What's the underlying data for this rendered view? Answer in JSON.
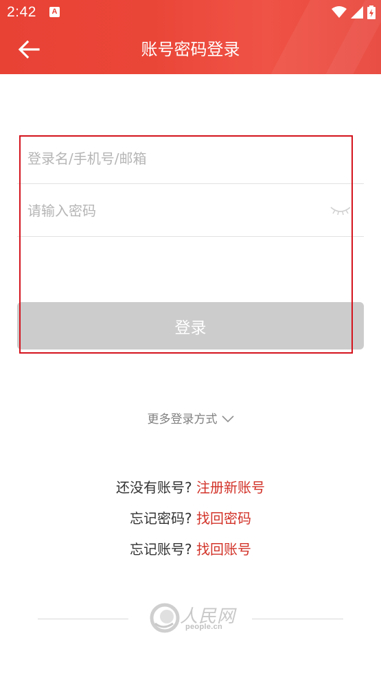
{
  "status_bar": {
    "time": "2:42",
    "notification_icon": "A"
  },
  "header": {
    "title": "账号密码登录",
    "back_icon": "arrow-left-icon"
  },
  "form": {
    "username_placeholder": "登录名/手机号/邮箱",
    "username_value": "",
    "password_placeholder": "请输入密码",
    "password_value": "",
    "login_label": "登录"
  },
  "more_login": {
    "label": "更多登录方式"
  },
  "links": {
    "register_prefix": "还没有账号?",
    "register_link": "注册新账号",
    "forgot_password_prefix": "忘记密码?",
    "forgot_password_link": "找回密码",
    "forgot_account_prefix": "忘记账号?",
    "forgot_account_link": "找回账号"
  },
  "footer": {
    "logo_cn": "人民网",
    "logo_en": "people.cn"
  },
  "colors": {
    "brand_red": "#e84235",
    "link_red": "#d23228",
    "button_disabled": "#cccccc",
    "highlight_border": "#d4121c"
  }
}
